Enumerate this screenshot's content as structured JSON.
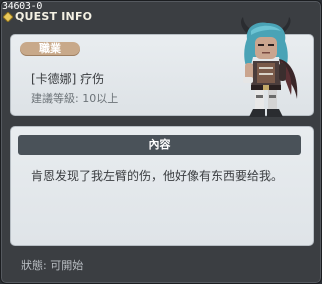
{
  "window": {
    "quest_id": "34603-0",
    "title": "QUEST INFO"
  },
  "top_panel": {
    "job_badge": "職業",
    "quest_name": "[卡德娜] 疗伤",
    "recommended_level": "建議等級: 10以上"
  },
  "content": {
    "header": "內容",
    "text": "肯恩发现了我左臂的伤，他好像有东西要给我。"
  },
  "status": "狀態:  可開始",
  "colors": {
    "window_bg": "#3b3e42",
    "panel_bg": "#e6eaed",
    "badge_bg": "#c8a98a",
    "header_bg": "#4a5259",
    "title_text": "#f4f1e4"
  },
  "icons": {
    "title_icon": "quest-info-icon",
    "character": "character-portrait"
  }
}
